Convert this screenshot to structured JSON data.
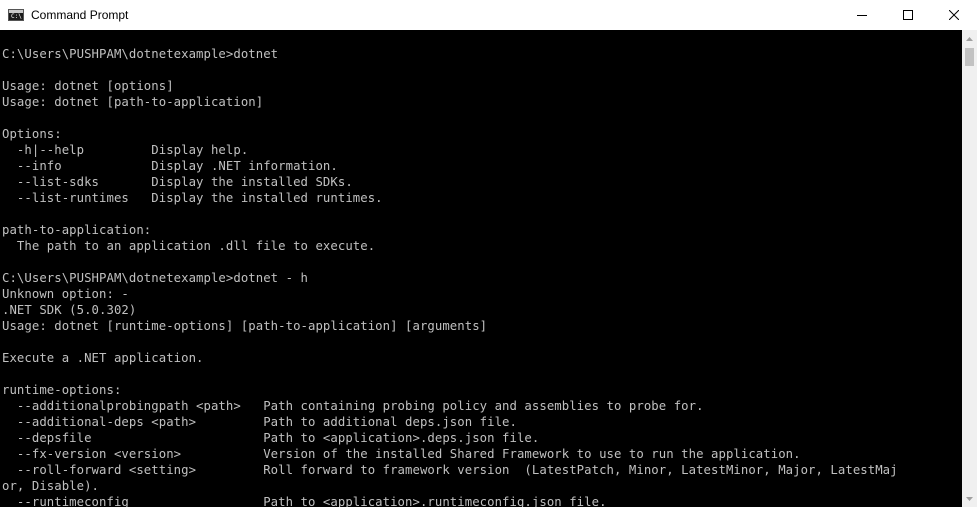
{
  "window": {
    "title": "Command Prompt",
    "app_icon_glyph": "C:\\"
  },
  "title_controls": {
    "minimize_icon": "minimize-icon",
    "maximize_icon": "maximize-icon",
    "close_icon": "close-icon"
  },
  "console": {
    "lines": [
      "C:\\Users\\PUSHPAM\\dotnetexample>dotnet",
      "",
      "Usage: dotnet [options]",
      "Usage: dotnet [path-to-application]",
      "",
      "Options:",
      "  -h|--help         Display help.",
      "  --info            Display .NET information.",
      "  --list-sdks       Display the installed SDKs.",
      "  --list-runtimes   Display the installed runtimes.",
      "",
      "path-to-application:",
      "  The path to an application .dll file to execute.",
      "",
      "C:\\Users\\PUSHPAM\\dotnetexample>dotnet - h",
      "Unknown option: -",
      ".NET SDK (5.0.302)",
      "Usage: dotnet [runtime-options] [path-to-application] [arguments]",
      "",
      "Execute a .NET application.",
      "",
      "runtime-options:",
      "  --additionalprobingpath <path>   Path containing probing policy and assemblies to probe for.",
      "  --additional-deps <path>         Path to additional deps.json file.",
      "  --depsfile                       Path to <application>.deps.json file.",
      "  --fx-version <version>           Version of the installed Shared Framework to use to run the application.",
      "  --roll-forward <setting>         Roll forward to framework version  (LatestPatch, Minor, LatestMinor, Major, LatestMaj",
      "or, Disable).",
      "  --runtimeconfig                  Path to <application>.runtimeconfig.json file."
    ]
  },
  "colors": {
    "console_background": "#000000",
    "console_text": "#c0c0c0",
    "titlebar_background": "#ffffff",
    "scrollbar_track": "#f0f0f0"
  }
}
